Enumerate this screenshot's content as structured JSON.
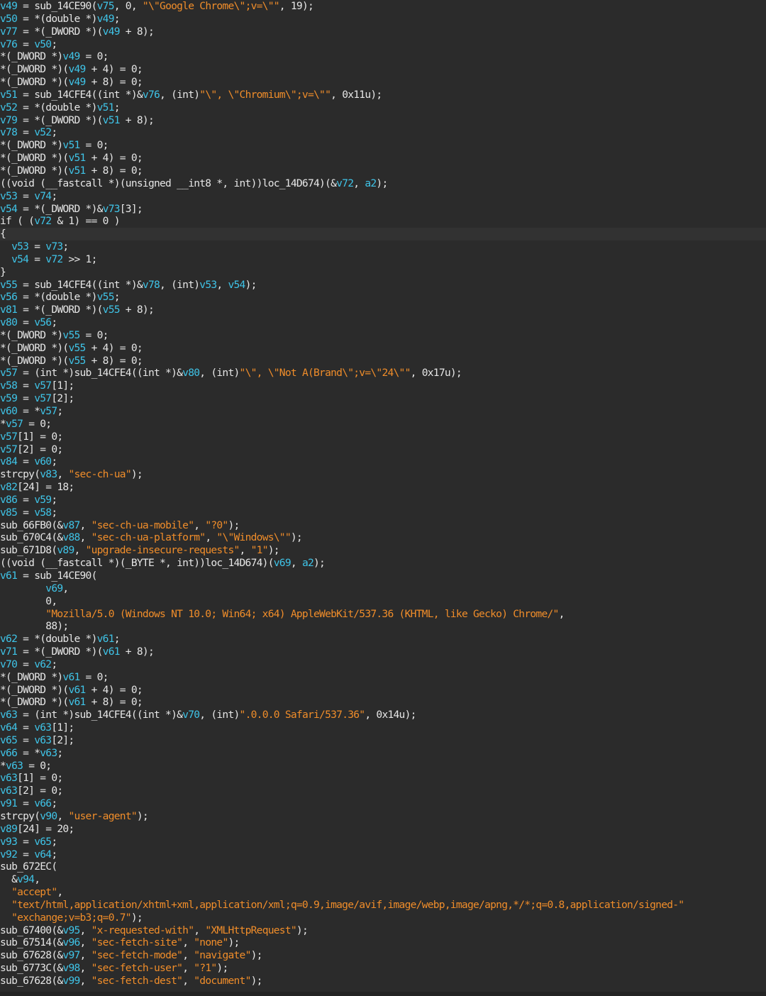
{
  "editor": {
    "current_line_index": 18,
    "colors": {
      "background": "#2b2b2b",
      "plain": "#e6e6e6",
      "variable": "#3fc4e8",
      "string": "#f08d2a"
    },
    "lines": [
      [
        [
          "v",
          "v49"
        ],
        [
          "p",
          " = sub_14CE90("
        ],
        [
          "v",
          "v75"
        ],
        [
          "p",
          ", 0, "
        ],
        [
          "s",
          "\"\\\"Google Chrome\\\";v=\\\"\""
        ],
        [
          "p",
          ", 19);"
        ]
      ],
      [
        [
          "v",
          "v50"
        ],
        [
          "p",
          " = *(double *)"
        ],
        [
          "v",
          "v49"
        ],
        [
          "p",
          ";"
        ]
      ],
      [
        [
          "v",
          "v77"
        ],
        [
          "p",
          " = *(_DWORD *)("
        ],
        [
          "v",
          "v49"
        ],
        [
          "p",
          " + 8);"
        ]
      ],
      [
        [
          "v",
          "v76"
        ],
        [
          "p",
          " = "
        ],
        [
          "v",
          "v50"
        ],
        [
          "p",
          ";"
        ]
      ],
      [
        [
          "p",
          "*(_DWORD *)"
        ],
        [
          "v",
          "v49"
        ],
        [
          "p",
          " = 0;"
        ]
      ],
      [
        [
          "p",
          "*(_DWORD *)("
        ],
        [
          "v",
          "v49"
        ],
        [
          "p",
          " + 4) = 0;"
        ]
      ],
      [
        [
          "p",
          "*(_DWORD *)("
        ],
        [
          "v",
          "v49"
        ],
        [
          "p",
          " + 8) = 0;"
        ]
      ],
      [
        [
          "v",
          "v51"
        ],
        [
          "p",
          " = sub_14CFE4((int *)&"
        ],
        [
          "v",
          "v76"
        ],
        [
          "p",
          ", (int)"
        ],
        [
          "s",
          "\"\\\", \\\"Chromium\\\";v=\\\"\""
        ],
        [
          "p",
          ", 0x11u);"
        ]
      ],
      [
        [
          "v",
          "v52"
        ],
        [
          "p",
          " = *(double *)"
        ],
        [
          "v",
          "v51"
        ],
        [
          "p",
          ";"
        ]
      ],
      [
        [
          "v",
          "v79"
        ],
        [
          "p",
          " = *(_DWORD *)("
        ],
        [
          "v",
          "v51"
        ],
        [
          "p",
          " + 8);"
        ]
      ],
      [
        [
          "v",
          "v78"
        ],
        [
          "p",
          " = "
        ],
        [
          "v",
          "v52"
        ],
        [
          "p",
          ";"
        ]
      ],
      [
        [
          "p",
          "*(_DWORD *)"
        ],
        [
          "v",
          "v51"
        ],
        [
          "p",
          " = 0;"
        ]
      ],
      [
        [
          "p",
          "*(_DWORD *)("
        ],
        [
          "v",
          "v51"
        ],
        [
          "p",
          " + 4) = 0;"
        ]
      ],
      [
        [
          "p",
          "*(_DWORD *)("
        ],
        [
          "v",
          "v51"
        ],
        [
          "p",
          " + 8) = 0;"
        ]
      ],
      [
        [
          "p",
          "((void (__fastcall *)(unsigned __int8 *, int))loc_14D674)(&"
        ],
        [
          "v",
          "v72"
        ],
        [
          "p",
          ", "
        ],
        [
          "v",
          "a2"
        ],
        [
          "p",
          ");"
        ]
      ],
      [
        [
          "v",
          "v53"
        ],
        [
          "p",
          " = "
        ],
        [
          "v",
          "v74"
        ],
        [
          "p",
          ";"
        ]
      ],
      [
        [
          "v",
          "v54"
        ],
        [
          "p",
          " = *(_DWORD *)&"
        ],
        [
          "v",
          "v73"
        ],
        [
          "p",
          "[3];"
        ]
      ],
      [
        [
          "p",
          "if ( ("
        ],
        [
          "v",
          "v72"
        ],
        [
          "p",
          " & 1) == 0 )"
        ]
      ],
      [
        [
          "p",
          "{"
        ]
      ],
      [
        [
          "p",
          "  "
        ],
        [
          "v",
          "v53"
        ],
        [
          "p",
          " = "
        ],
        [
          "v",
          "v73"
        ],
        [
          "p",
          ";"
        ]
      ],
      [
        [
          "p",
          "  "
        ],
        [
          "v",
          "v54"
        ],
        [
          "p",
          " = "
        ],
        [
          "v",
          "v72"
        ],
        [
          "p",
          " >> 1;"
        ]
      ],
      [
        [
          "p",
          "}"
        ]
      ],
      [
        [
          "v",
          "v55"
        ],
        [
          "p",
          " = sub_14CFE4((int *)&"
        ],
        [
          "v",
          "v78"
        ],
        [
          "p",
          ", (int)"
        ],
        [
          "v",
          "v53"
        ],
        [
          "p",
          ", "
        ],
        [
          "v",
          "v54"
        ],
        [
          "p",
          ");"
        ]
      ],
      [
        [
          "v",
          "v56"
        ],
        [
          "p",
          " = *(double *)"
        ],
        [
          "v",
          "v55"
        ],
        [
          "p",
          ";"
        ]
      ],
      [
        [
          "v",
          "v81"
        ],
        [
          "p",
          " = *(_DWORD *)("
        ],
        [
          "v",
          "v55"
        ],
        [
          "p",
          " + 8);"
        ]
      ],
      [
        [
          "v",
          "v80"
        ],
        [
          "p",
          " = "
        ],
        [
          "v",
          "v56"
        ],
        [
          "p",
          ";"
        ]
      ],
      [
        [
          "p",
          "*(_DWORD *)"
        ],
        [
          "v",
          "v55"
        ],
        [
          "p",
          " = 0;"
        ]
      ],
      [
        [
          "p",
          "*(_DWORD *)("
        ],
        [
          "v",
          "v55"
        ],
        [
          "p",
          " + 4) = 0;"
        ]
      ],
      [
        [
          "p",
          "*(_DWORD *)("
        ],
        [
          "v",
          "v55"
        ],
        [
          "p",
          " + 8) = 0;"
        ]
      ],
      [
        [
          "v",
          "v57"
        ],
        [
          "p",
          " = (int *)sub_14CFE4((int *)&"
        ],
        [
          "v",
          "v80"
        ],
        [
          "p",
          ", (int)"
        ],
        [
          "s",
          "\"\\\", \\\"Not A(Brand\\\";v=\\\"24\\\"\""
        ],
        [
          "p",
          ", 0x17u);"
        ]
      ],
      [
        [
          "v",
          "v58"
        ],
        [
          "p",
          " = "
        ],
        [
          "v",
          "v57"
        ],
        [
          "p",
          "[1];"
        ]
      ],
      [
        [
          "v",
          "v59"
        ],
        [
          "p",
          " = "
        ],
        [
          "v",
          "v57"
        ],
        [
          "p",
          "[2];"
        ]
      ],
      [
        [
          "v",
          "v60"
        ],
        [
          "p",
          " = *"
        ],
        [
          "v",
          "v57"
        ],
        [
          "p",
          ";"
        ]
      ],
      [
        [
          "p",
          "*"
        ],
        [
          "v",
          "v57"
        ],
        [
          "p",
          " = 0;"
        ]
      ],
      [
        [
          "v",
          "v57"
        ],
        [
          "p",
          "[1] = 0;"
        ]
      ],
      [
        [
          "v",
          "v57"
        ],
        [
          "p",
          "[2] = 0;"
        ]
      ],
      [
        [
          "v",
          "v84"
        ],
        [
          "p",
          " = "
        ],
        [
          "v",
          "v60"
        ],
        [
          "p",
          ";"
        ]
      ],
      [
        [
          "p",
          "strcpy("
        ],
        [
          "v",
          "v83"
        ],
        [
          "p",
          ", "
        ],
        [
          "s",
          "\"sec-ch-ua\""
        ],
        [
          "p",
          ");"
        ]
      ],
      [
        [
          "v",
          "v82"
        ],
        [
          "p",
          "[24] = 18;"
        ]
      ],
      [
        [
          "v",
          "v86"
        ],
        [
          "p",
          " = "
        ],
        [
          "v",
          "v59"
        ],
        [
          "p",
          ";"
        ]
      ],
      [
        [
          "v",
          "v85"
        ],
        [
          "p",
          " = "
        ],
        [
          "v",
          "v58"
        ],
        [
          "p",
          ";"
        ]
      ],
      [
        [
          "p",
          "sub_66FB0(&"
        ],
        [
          "v",
          "v87"
        ],
        [
          "p",
          ", "
        ],
        [
          "s",
          "\"sec-ch-ua-mobile\""
        ],
        [
          "p",
          ", "
        ],
        [
          "s",
          "\"?0\""
        ],
        [
          "p",
          ");"
        ]
      ],
      [
        [
          "p",
          "sub_670C4(&"
        ],
        [
          "v",
          "v88"
        ],
        [
          "p",
          ", "
        ],
        [
          "s",
          "\"sec-ch-ua-platform\""
        ],
        [
          "p",
          ", "
        ],
        [
          "s",
          "\"\\\"Windows\\\"\""
        ],
        [
          "p",
          ");"
        ]
      ],
      [
        [
          "p",
          "sub_671D8("
        ],
        [
          "v",
          "v89"
        ],
        [
          "p",
          ", "
        ],
        [
          "s",
          "\"upgrade-insecure-requests\""
        ],
        [
          "p",
          ", "
        ],
        [
          "s",
          "\"1\""
        ],
        [
          "p",
          ");"
        ]
      ],
      [
        [
          "p",
          "((void (__fastcall *)(_BYTE *, int))loc_14D674)("
        ],
        [
          "v",
          "v69"
        ],
        [
          "p",
          ", "
        ],
        [
          "v",
          "a2"
        ],
        [
          "p",
          ");"
        ]
      ],
      [
        [
          "v",
          "v61"
        ],
        [
          "p",
          " = sub_14CE90("
        ]
      ],
      [
        [
          "p",
          "        "
        ],
        [
          "v",
          "v69"
        ],
        [
          "p",
          ","
        ]
      ],
      [
        [
          "p",
          "        0,"
        ]
      ],
      [
        [
          "p",
          "        "
        ],
        [
          "s",
          "\"Mozilla/5.0 (Windows NT 10.0; Win64; x64) AppleWebKit/537.36 (KHTML, like Gecko) Chrome/\""
        ],
        [
          "p",
          ","
        ]
      ],
      [
        [
          "p",
          "        88);"
        ]
      ],
      [
        [
          "v",
          "v62"
        ],
        [
          "p",
          " = *(double *)"
        ],
        [
          "v",
          "v61"
        ],
        [
          "p",
          ";"
        ]
      ],
      [
        [
          "v",
          "v71"
        ],
        [
          "p",
          " = *(_DWORD *)("
        ],
        [
          "v",
          "v61"
        ],
        [
          "p",
          " + 8);"
        ]
      ],
      [
        [
          "v",
          "v70"
        ],
        [
          "p",
          " = "
        ],
        [
          "v",
          "v62"
        ],
        [
          "p",
          ";"
        ]
      ],
      [
        [
          "p",
          "*(_DWORD *)"
        ],
        [
          "v",
          "v61"
        ],
        [
          "p",
          " = 0;"
        ]
      ],
      [
        [
          "p",
          "*(_DWORD *)("
        ],
        [
          "v",
          "v61"
        ],
        [
          "p",
          " + 4) = 0;"
        ]
      ],
      [
        [
          "p",
          "*(_DWORD *)("
        ],
        [
          "v",
          "v61"
        ],
        [
          "p",
          " + 8) = 0;"
        ]
      ],
      [
        [
          "v",
          "v63"
        ],
        [
          "p",
          " = (int *)sub_14CFE4((int *)&"
        ],
        [
          "v",
          "v70"
        ],
        [
          "p",
          ", (int)"
        ],
        [
          "s",
          "\".0.0.0 Safari/537.36\""
        ],
        [
          "p",
          ", 0x14u);"
        ]
      ],
      [
        [
          "v",
          "v64"
        ],
        [
          "p",
          " = "
        ],
        [
          "v",
          "v63"
        ],
        [
          "p",
          "[1];"
        ]
      ],
      [
        [
          "v",
          "v65"
        ],
        [
          "p",
          " = "
        ],
        [
          "v",
          "v63"
        ],
        [
          "p",
          "[2];"
        ]
      ],
      [
        [
          "v",
          "v66"
        ],
        [
          "p",
          " = *"
        ],
        [
          "v",
          "v63"
        ],
        [
          "p",
          ";"
        ]
      ],
      [
        [
          "p",
          "*"
        ],
        [
          "v",
          "v63"
        ],
        [
          "p",
          " = 0;"
        ]
      ],
      [
        [
          "v",
          "v63"
        ],
        [
          "p",
          "[1] = 0;"
        ]
      ],
      [
        [
          "v",
          "v63"
        ],
        [
          "p",
          "[2] = 0;"
        ]
      ],
      [
        [
          "v",
          "v91"
        ],
        [
          "p",
          " = "
        ],
        [
          "v",
          "v66"
        ],
        [
          "p",
          ";"
        ]
      ],
      [
        [
          "p",
          "strcpy("
        ],
        [
          "v",
          "v90"
        ],
        [
          "p",
          ", "
        ],
        [
          "s",
          "\"user-agent\""
        ],
        [
          "p",
          ");"
        ]
      ],
      [
        [
          "v",
          "v89"
        ],
        [
          "p",
          "[24] = 20;"
        ]
      ],
      [
        [
          "v",
          "v93"
        ],
        [
          "p",
          " = "
        ],
        [
          "v",
          "v65"
        ],
        [
          "p",
          ";"
        ]
      ],
      [
        [
          "v",
          "v92"
        ],
        [
          "p",
          " = "
        ],
        [
          "v",
          "v64"
        ],
        [
          "p",
          ";"
        ]
      ],
      [
        [
          "p",
          "sub_672EC("
        ]
      ],
      [
        [
          "p",
          "  &"
        ],
        [
          "v",
          "v94"
        ],
        [
          "p",
          ","
        ]
      ],
      [
        [
          "p",
          "  "
        ],
        [
          "s",
          "\"accept\""
        ],
        [
          "p",
          ","
        ]
      ],
      [
        [
          "p",
          "  "
        ],
        [
          "s",
          "\"text/html,application/xhtml+xml,application/xml;q=0.9,image/avif,image/webp,image/apng,*/*;q=0.8,application/signed-\""
        ]
      ],
      [
        [
          "p",
          "  "
        ],
        [
          "s",
          "\"exchange;v=b3;q=0.7\""
        ],
        [
          "p",
          ");"
        ]
      ],
      [
        [
          "p",
          "sub_67400(&"
        ],
        [
          "v",
          "v95"
        ],
        [
          "p",
          ", "
        ],
        [
          "s",
          "\"x-requested-with\""
        ],
        [
          "p",
          ", "
        ],
        [
          "s",
          "\"XMLHttpRequest\""
        ],
        [
          "p",
          ");"
        ]
      ],
      [
        [
          "p",
          "sub_67514(&"
        ],
        [
          "v",
          "v96"
        ],
        [
          "p",
          ", "
        ],
        [
          "s",
          "\"sec-fetch-site\""
        ],
        [
          "p",
          ", "
        ],
        [
          "s",
          "\"none\""
        ],
        [
          "p",
          ");"
        ]
      ],
      [
        [
          "p",
          "sub_67628(&"
        ],
        [
          "v",
          "v97"
        ],
        [
          "p",
          ", "
        ],
        [
          "s",
          "\"sec-fetch-mode\""
        ],
        [
          "p",
          ", "
        ],
        [
          "s",
          "\"navigate\""
        ],
        [
          "p",
          ");"
        ]
      ],
      [
        [
          "p",
          "sub_6773C(&"
        ],
        [
          "v",
          "v98"
        ],
        [
          "p",
          ", "
        ],
        [
          "s",
          "\"sec-fetch-user\""
        ],
        [
          "p",
          ", "
        ],
        [
          "s",
          "\"?1\""
        ],
        [
          "p",
          ");"
        ]
      ],
      [
        [
          "p",
          "sub_67628(&"
        ],
        [
          "v",
          "v99"
        ],
        [
          "p",
          ", "
        ],
        [
          "s",
          "\"sec-fetch-dest\""
        ],
        [
          "p",
          ", "
        ],
        [
          "s",
          "\"document\""
        ],
        [
          "p",
          ");"
        ]
      ]
    ]
  }
}
